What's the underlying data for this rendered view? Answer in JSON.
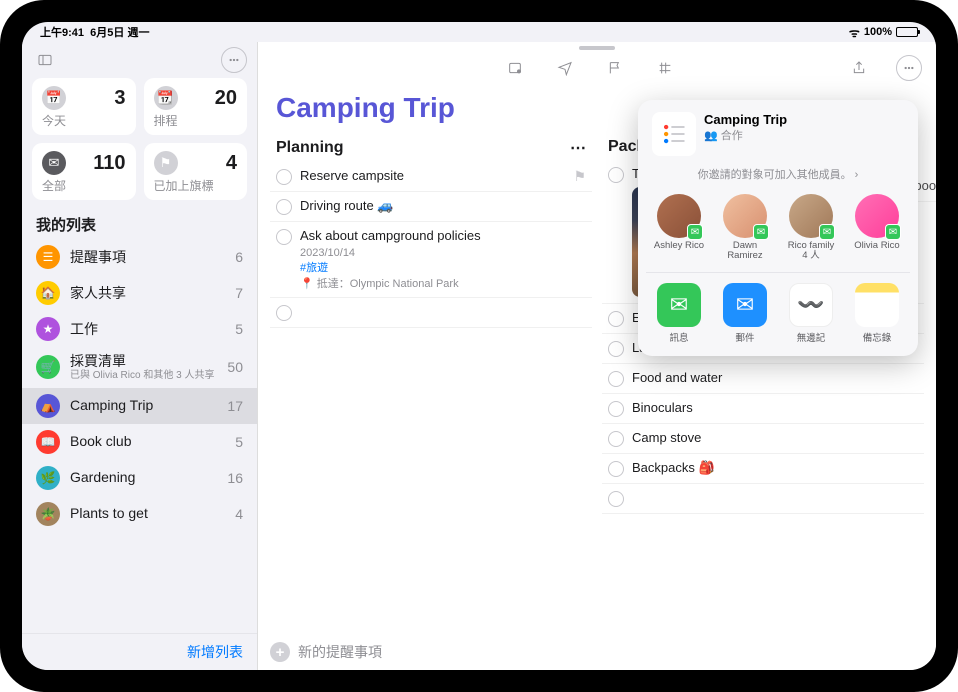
{
  "status": {
    "time": "上午9:41",
    "date": "6月5日 週一",
    "battery": "100%"
  },
  "sidebar": {
    "smart": [
      {
        "label": "今天",
        "count": "3"
      },
      {
        "label": "排程",
        "count": "20"
      },
      {
        "label": "全部",
        "count": "110"
      },
      {
        "label": "已加上旗標",
        "count": "4"
      }
    ],
    "my_lists_header": "我的列表",
    "lists": [
      {
        "name": "提醒事項",
        "count": "6"
      },
      {
        "name": "家人共享",
        "count": "7"
      },
      {
        "name": "工作",
        "count": "5"
      },
      {
        "name": "採買清單",
        "sub": "已與 Olivia Rico 和其他 3 人共享",
        "count": "50"
      },
      {
        "name": "Camping Trip",
        "count": "17",
        "selected": true
      },
      {
        "name": "Book club",
        "count": "5"
      },
      {
        "name": "Gardening",
        "count": "16"
      },
      {
        "name": "Plants to get",
        "count": "4"
      }
    ],
    "new_list": "新增列表"
  },
  "main": {
    "title": "Camping Trip",
    "new_reminder": "新的提醒事項",
    "columns": [
      {
        "header": "Planning",
        "tasks": [
          {
            "title": "Reserve campsite",
            "flagged": true
          },
          {
            "title": "Driving route 🚙"
          },
          {
            "title": "Ask about campground policies",
            "date": "2023/10/14",
            "tag": "#旅遊",
            "loc": "抵達：Olympic National Park"
          }
        ]
      },
      {
        "header": "Packing",
        "tasks": [
          {
            "title": "Tent & sleeping bags",
            "image": true
          },
          {
            "title": "Extra blankets"
          },
          {
            "title": "Lanterns"
          },
          {
            "title": "Food and water"
          },
          {
            "title": "Binoculars"
          },
          {
            "title": "Camp stove"
          },
          {
            "title": "Backpacks 🎒"
          }
        ]
      }
    ],
    "overflow_task": "Tide pools"
  },
  "share": {
    "title": "Camping Trip",
    "mode": "合作",
    "note": "你邀請的對象可加入其他成員。",
    "people": [
      {
        "name": "Ashley Rico"
      },
      {
        "name": "Dawn Ramirez"
      },
      {
        "name": "Rico family",
        "sub": "4 人"
      },
      {
        "name": "Olivia Rico"
      }
    ],
    "apps": [
      {
        "name": "訊息"
      },
      {
        "name": "郵件"
      },
      {
        "name": "無邊記"
      },
      {
        "name": "備忘錄"
      }
    ]
  }
}
